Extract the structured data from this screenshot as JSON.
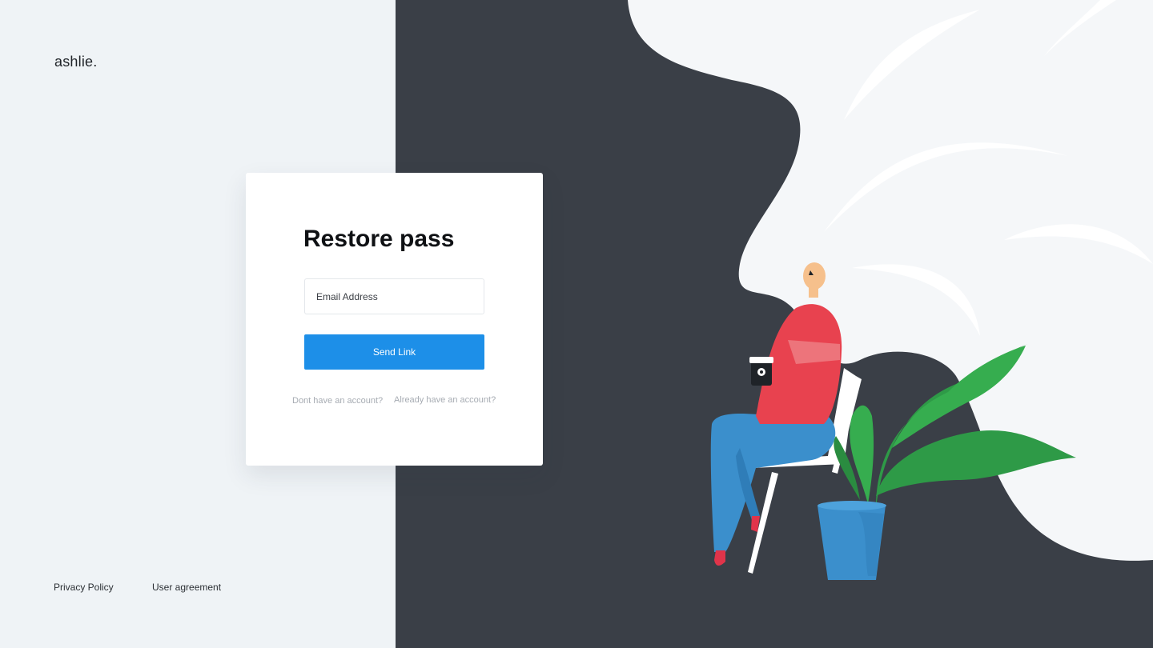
{
  "brand": {
    "logo": "ashlie."
  },
  "form": {
    "title": "Restore pass",
    "email_placeholder": "Email Address",
    "submit_label": "Send Link",
    "signup_link": "Dont have an account?",
    "login_link": "Already have an account?"
  },
  "footer": {
    "privacy": "Privacy Policy",
    "agreement": "User agreement"
  },
  "colors": {
    "accent": "#1d8fe8",
    "dark_panel": "#3a3f47",
    "light_panel": "#eff3f6"
  }
}
